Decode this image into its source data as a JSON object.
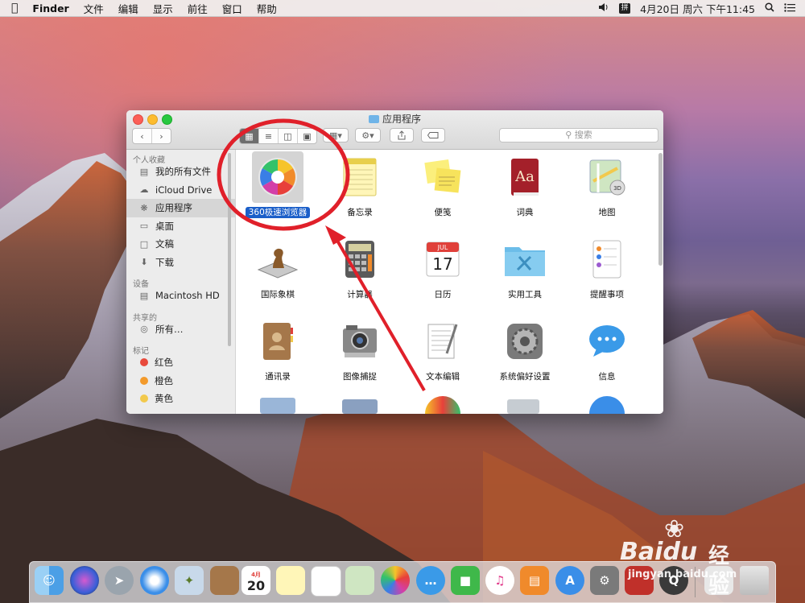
{
  "menubar": {
    "app": "Finder",
    "menus": [
      "文件",
      "编辑",
      "显示",
      "前往",
      "窗口",
      "帮助"
    ],
    "ime": "拼",
    "datetime": "4月20日 周六 下午11:45"
  },
  "window": {
    "title": "应用程序",
    "search_placeholder": "搜索"
  },
  "sidebar": {
    "sections": [
      {
        "header": "个人收藏",
        "items": [
          {
            "label": "我的所有文件",
            "icon": "all-files-icon"
          },
          {
            "label": "iCloud Drive",
            "icon": "cloud-icon"
          },
          {
            "label": "应用程序",
            "icon": "applications-icon",
            "selected": true
          },
          {
            "label": "桌面",
            "icon": "desktop-icon"
          },
          {
            "label": "文稿",
            "icon": "document-icon"
          },
          {
            "label": "下载",
            "icon": "download-icon"
          }
        ]
      },
      {
        "header": "设备",
        "items": [
          {
            "label": "Macintosh HD",
            "icon": "hard-drive-icon"
          }
        ]
      },
      {
        "header": "共享的",
        "items": [
          {
            "label": "所有…",
            "icon": "network-icon"
          }
        ]
      },
      {
        "header": "标记",
        "items": [
          {
            "label": "红色",
            "color": "#e84a3c"
          },
          {
            "label": "橙色",
            "color": "#f39a2b"
          },
          {
            "label": "黄色",
            "color": "#f2c94c"
          }
        ]
      }
    ]
  },
  "apps": [
    {
      "label": "360极速浏览器",
      "icon": "360-browser-icon",
      "selected": true
    },
    {
      "label": "备忘录",
      "icon": "notes-icon"
    },
    {
      "label": "便笺",
      "icon": "stickies-icon"
    },
    {
      "label": "词典",
      "icon": "dictionary-icon"
    },
    {
      "label": "地图",
      "icon": "maps-icon"
    },
    {
      "label": "国际象棋",
      "icon": "chess-icon"
    },
    {
      "label": "计算器",
      "icon": "calculator-icon"
    },
    {
      "label": "日历",
      "icon": "calendar-icon",
      "cal_month": "JUL",
      "cal_day": "17"
    },
    {
      "label": "实用工具",
      "icon": "utilities-folder-icon"
    },
    {
      "label": "提醒事项",
      "icon": "reminders-icon"
    },
    {
      "label": "通讯录",
      "icon": "contacts-icon"
    },
    {
      "label": "图像捕捉",
      "icon": "image-capture-icon"
    },
    {
      "label": "文本编辑",
      "icon": "textedit-icon"
    },
    {
      "label": "系统偏好设置",
      "icon": "system-preferences-icon"
    },
    {
      "label": "信息",
      "icon": "messages-icon"
    }
  ],
  "dock": {
    "calendar_day": "20",
    "calendar_month": "4月",
    "items": [
      "finder-icon",
      "siri-icon",
      "launchpad-icon",
      "safari-icon",
      "mail-icon",
      "contacts-icon",
      "calendar-icon",
      "notes-icon",
      "reminders-icon",
      "maps-icon",
      "photos-icon",
      "messages-icon",
      "facetime-icon",
      "itunes-icon",
      "ibooks-icon",
      "app-store-icon",
      "system-preferences-icon",
      "photo-booth-icon",
      "quicktime-icon",
      "trash-icon"
    ]
  },
  "watermark": {
    "brand": "Baidu",
    "suffix": "经验",
    "url": "jingyan.baidu.com"
  },
  "colors": {
    "annotation_red": "#e0202a",
    "selection_blue": "#1b5fc9"
  }
}
